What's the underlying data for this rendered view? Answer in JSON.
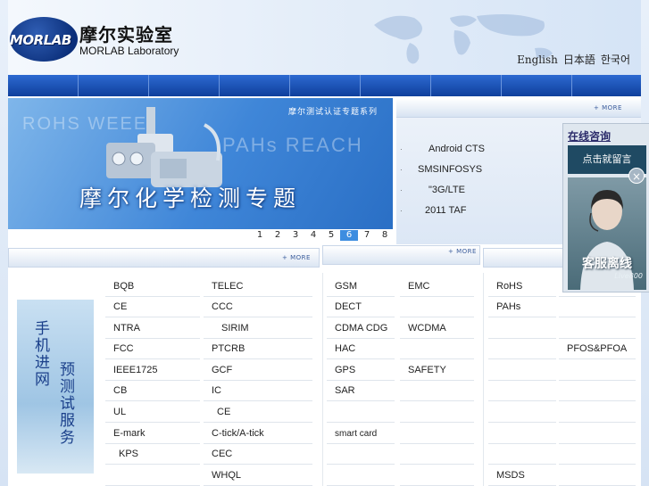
{
  "header": {
    "logo_text": "MORLAB",
    "brand_cn": "摩尔实验室",
    "brand_en": "MORLAB Laboratory",
    "languages": [
      "English",
      "日本語",
      "한국어"
    ]
  },
  "banner": {
    "ghost_text_1": "ROHS WEEE",
    "ghost_text_2": "PAHs REACH",
    "series_label": "摩尔测试认证专题系列",
    "title": "摩尔化学检测专题",
    "pages": [
      "1",
      "2",
      "3",
      "4",
      "5",
      "6",
      "7",
      "8"
    ],
    "active_page": "6"
  },
  "news": {
    "more": "+ MORE",
    "items": [
      {
        "bullet": "·",
        "text": "Android CTS"
      },
      {
        "bullet": "·",
        "text": "SMSINFOSYS"
      },
      {
        "bullet": "·",
        "text": "\"3G/LTE"
      },
      {
        "bullet": "·",
        "text": "2011  TAF"
      }
    ]
  },
  "chat": {
    "title": "在线咨询",
    "message_button": "点击就留言",
    "close_symbol": "×",
    "offline_text": "客服离线",
    "live_label": "Live800"
  },
  "sections": {
    "more": "+ MORE"
  },
  "promo": {
    "line1": "手机进网",
    "line2": "预测试服务"
  },
  "lists": {
    "col1": [
      "BQB",
      "CE",
      "NTRA",
      "FCC",
      "IEEE1725",
      "CB",
      "UL",
      "E-mark",
      "KPS",
      ""
    ],
    "col2": [
      "TELEC",
      "CCC",
      "SIRIM",
      "PTCRB",
      "GCF",
      "IC",
      "CE",
      "C-tick/A-tick",
      "CEC",
      "WHQL"
    ],
    "col3": [
      "GSM",
      "DECT",
      "CDMA CDG",
      "HAC",
      "GPS",
      "SAR",
      "",
      "smart card",
      "",
      ""
    ],
    "col4": [
      "EMC",
      "",
      "WCDMA",
      "",
      "SAFETY",
      "",
      "",
      "",
      "",
      ""
    ],
    "col5": [
      "RoHS",
      "PAHs",
      "",
      "",
      "",
      "",
      "",
      "",
      "",
      "MSDS"
    ],
    "col6": [
      "",
      "",
      "",
      "PFOS&PFOA",
      "",
      "",
      "",
      "",
      "",
      ""
    ]
  }
}
